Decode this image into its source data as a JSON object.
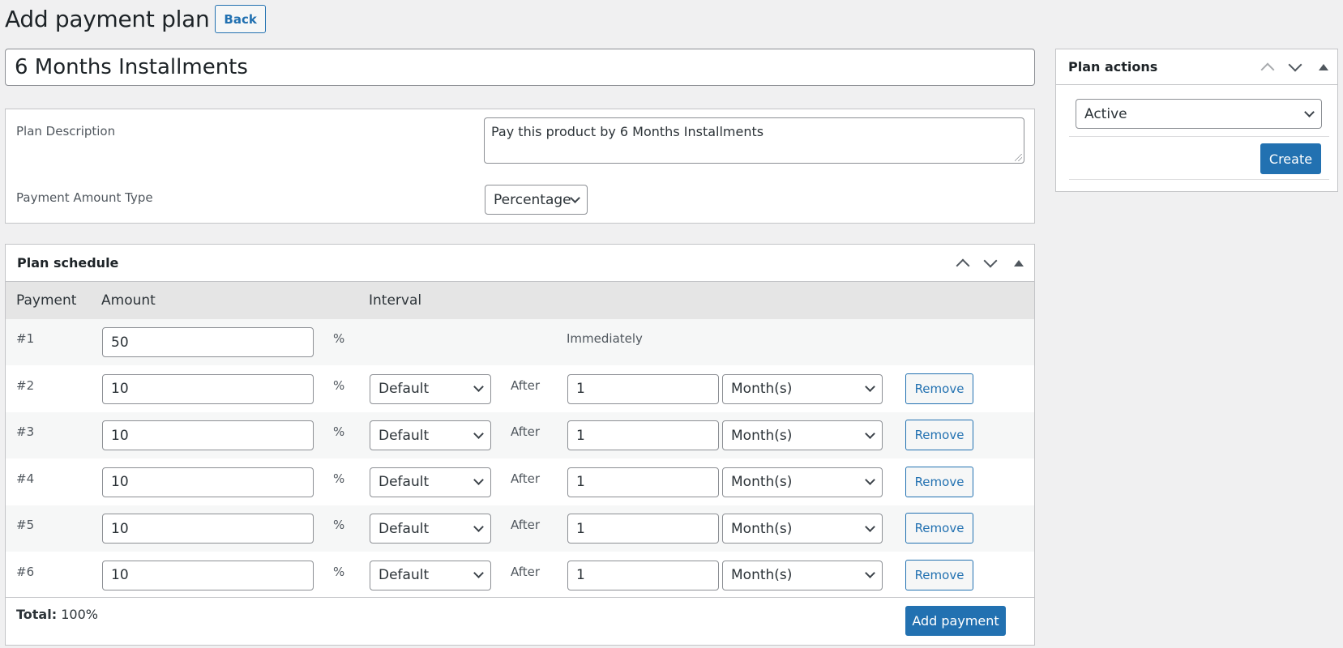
{
  "page": {
    "title": "Add payment plan",
    "back_label": "Back",
    "plan_name": "6 Months Installments"
  },
  "details": {
    "description_label": "Plan Description",
    "description_value": "Pay this product by 6 Months Installments",
    "amount_type_label": "Payment Amount Type",
    "amount_type_value": "Percentage"
  },
  "schedule": {
    "title": "Plan schedule",
    "columns": [
      "Payment",
      "Amount",
      "Interval"
    ],
    "percent_symbol": "%",
    "after_label": "After",
    "immediately_label": "Immediately",
    "remove_label": "Remove",
    "rows": [
      {
        "number": "#1",
        "amount": "50"
      },
      {
        "number": "#2",
        "amount": "10",
        "interval_type": "Default",
        "after_value": "1",
        "period": "Month(s)"
      },
      {
        "number": "#3",
        "amount": "10",
        "interval_type": "Default",
        "after_value": "1",
        "period": "Month(s)"
      },
      {
        "number": "#4",
        "amount": "10",
        "interval_type": "Default",
        "after_value": "1",
        "period": "Month(s)"
      },
      {
        "number": "#5",
        "amount": "10",
        "interval_type": "Default",
        "after_value": "1",
        "period": "Month(s)"
      },
      {
        "number": "#6",
        "amount": "10",
        "interval_type": "Default",
        "after_value": "1",
        "period": "Month(s)"
      }
    ],
    "total_label": "Total:",
    "total_value": "100%",
    "add_payment_label": "Add payment"
  },
  "actions": {
    "title": "Plan actions",
    "status_value": "Active",
    "create_label": "Create"
  },
  "colors": {
    "accent": "#2271b1",
    "background": "#f0f0f1"
  }
}
